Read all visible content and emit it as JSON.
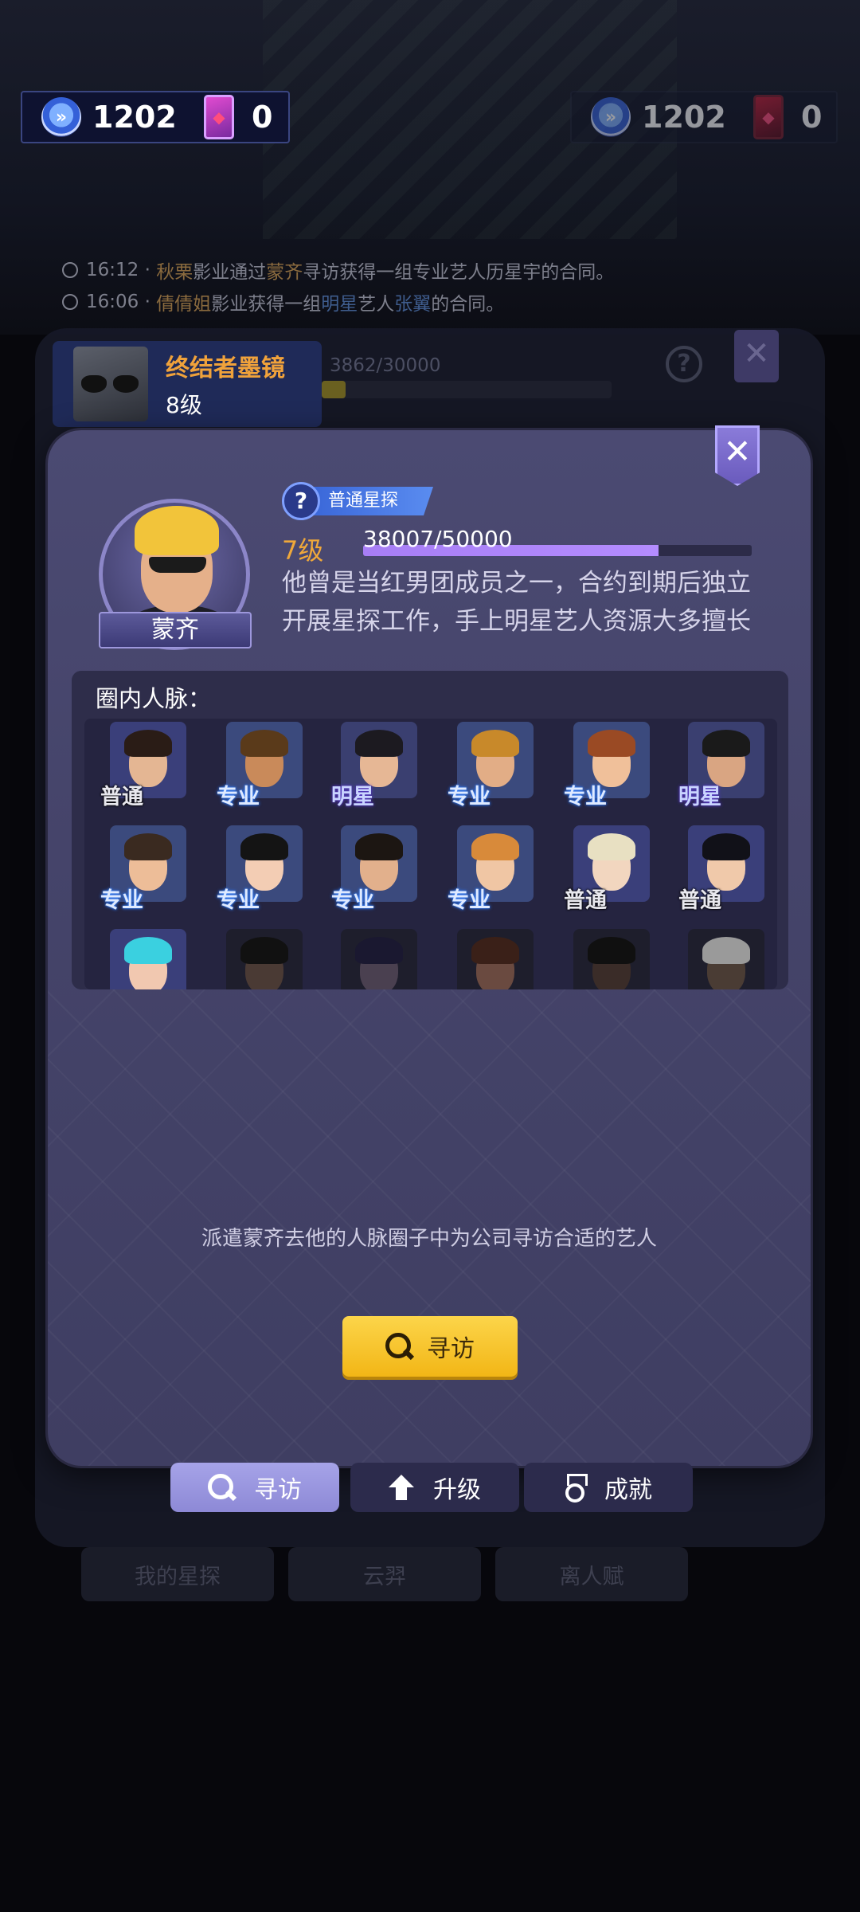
{
  "resources": {
    "stopwatch_value": "1202",
    "card_value": "0",
    "dim_stopwatch_value": "1202",
    "dim_card_value": "0"
  },
  "news": [
    {
      "time": "16:12",
      "sep": "·",
      "company": "秋栗",
      "text1": "影业通过",
      "person": "蒙齐",
      "text2": "寻访获得一组专业艺人历星宇的合同。"
    },
    {
      "time": "16:06",
      "sep": "·",
      "company": "倩倩姐",
      "text1": "影业获得一组",
      "person": "明星",
      "text2": "艺人",
      "person2": "张翼",
      "text3": "的合同。"
    }
  ],
  "background_panel": {
    "item_name": "终结者墨镜",
    "item_level": "8级",
    "progress_text": "3862/30000",
    "help_label": "?",
    "close_label": "✕",
    "tabs": [
      "我的星探",
      "云羿",
      "离人赋"
    ]
  },
  "scout": {
    "name": "蒙齐",
    "title": "普通星探",
    "level": "7级",
    "xp_text": "38007/50000",
    "xp_fraction": 0.76,
    "bio": "他曾是当红男团成员之一，合约到期后独立开展星探工作，手上明星艺人资源大多擅长"
  },
  "contacts": {
    "title": "圈内人脉：",
    "rows": [
      [
        {
          "rank": "普通",
          "type": "normal",
          "skin": "#e4b693",
          "hair": "#2a1c16",
          "bg": "#3a3f7a"
        },
        {
          "rank": "专业",
          "type": "pro",
          "skin": "#c98a5a",
          "hair": "#5a3a1a",
          "bg": "#3b4a7d"
        },
        {
          "rank": "明星",
          "type": "star",
          "skin": "#e6b795",
          "hair": "#1c1a20",
          "bg": "#3a3f70"
        },
        {
          "rank": "专业",
          "type": "pro",
          "skin": "#e2ad86",
          "hair": "#c8892a",
          "bg": "#3b4a7d"
        },
        {
          "rank": "专业",
          "type": "pro",
          "skin": "#f0c09a",
          "hair": "#9a4a24",
          "bg": "#3b4a7d"
        },
        {
          "rank": "明星",
          "type": "star",
          "skin": "#d9a582",
          "hair": "#1a1a1a",
          "bg": "#3a3f70"
        }
      ],
      [
        {
          "rank": "专业",
          "type": "pro",
          "skin": "#edbd98",
          "hair": "#3a2a20",
          "bg": "#3b4a7d"
        },
        {
          "rank": "专业",
          "type": "pro",
          "skin": "#f3cdb4",
          "hair": "#141414",
          "bg": "#3b4a7d"
        },
        {
          "rank": "专业",
          "type": "pro",
          "skin": "#e2b08c",
          "hair": "#1c1612",
          "bg": "#3b4a7d"
        },
        {
          "rank": "专业",
          "type": "pro",
          "skin": "#f0c6a4",
          "hair": "#d88a3a",
          "bg": "#3b4a7d"
        },
        {
          "rank": "普通",
          "type": "normal",
          "skin": "#f2d6bf",
          "hair": "#e8e0c2",
          "bg": "#3a3f7a"
        },
        {
          "rank": "普通",
          "type": "normal",
          "skin": "#f0c9aa",
          "hair": "#111118",
          "bg": "#3a3f7a"
        }
      ],
      [
        {
          "rank": "",
          "type": "normal",
          "skin": "#f1c8b0",
          "hair": "#3ad0e0",
          "bg": "#3a3f7a",
          "lock": false
        },
        {
          "rank": "",
          "type": "normal",
          "skin": "#4a3a34",
          "hair": "#111",
          "bg": "#1e1e2c",
          "lock": true
        },
        {
          "rank": "",
          "type": "normal",
          "skin": "#4a4050",
          "hair": "#1a1830",
          "bg": "#1e1e2c",
          "lock": true
        },
        {
          "rank": "",
          "type": "normal",
          "skin": "#6a4a40",
          "hair": "#3a2018",
          "bg": "#1e1e2c",
          "lock": true
        },
        {
          "rank": "",
          "type": "normal",
          "skin": "#3a2c28",
          "hair": "#101010",
          "bg": "#1e1e2c",
          "lock": true
        },
        {
          "rank": "",
          "type": "normal",
          "skin": "#4a3c34",
          "hair": "#9a9a9a",
          "bg": "#1e1e2c",
          "lock": true
        }
      ]
    ]
  },
  "hint": "派遣蒙齐去他的人脉圈子中为公司寻访合适的艺人",
  "search_button": "寻访",
  "close_label": "✕",
  "tabs": {
    "search": "寻访",
    "upgrade": "升级",
    "achievement": "成就"
  },
  "colors": {
    "dialog_bg": "#4b4a72",
    "accent_yellow": "#f2b616",
    "xp_purple": "#a77ef5",
    "level_orange": "#f0a83a"
  }
}
